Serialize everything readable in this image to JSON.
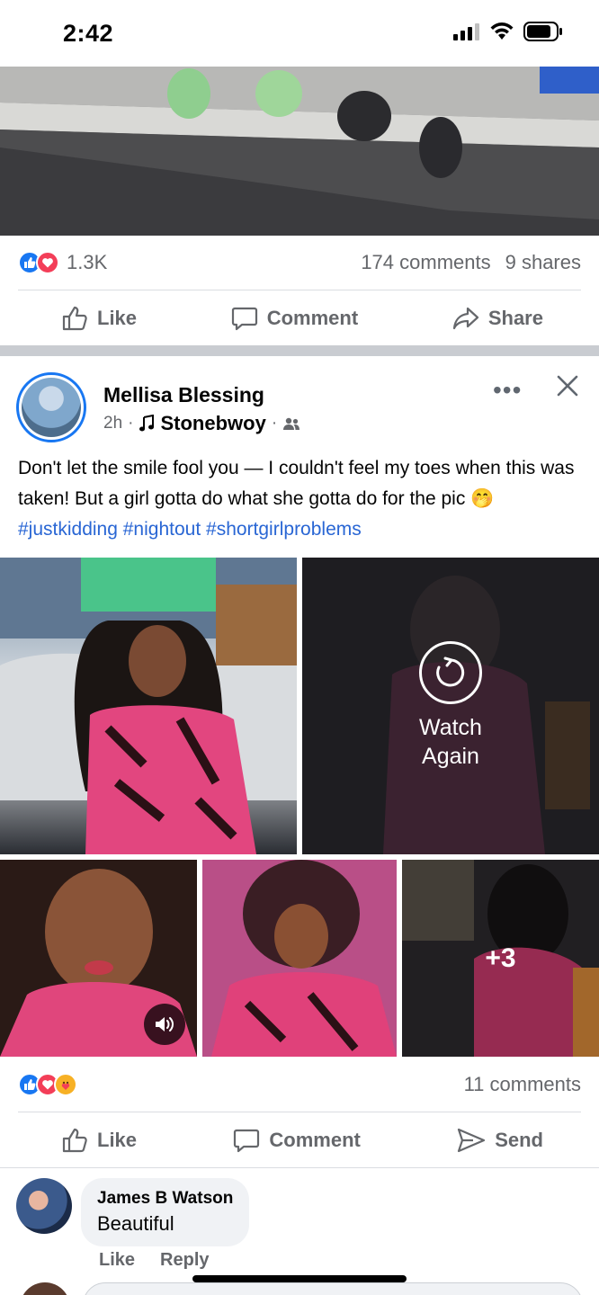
{
  "status": {
    "time": "2:42"
  },
  "top_post": {
    "reaction_count": "1.3K",
    "comments": "174 comments",
    "shares": "9 shares",
    "actions": {
      "like": "Like",
      "comment": "Comment",
      "share": "Share"
    }
  },
  "post": {
    "author": "Mellisa Blessing",
    "time": "2h",
    "song": "Stonebwoy",
    "text_plain": "Don't let the smile fool you — I couldn't feel my toes when this was taken! But a girl gotta do what she gotta do for the pic 🤭",
    "hashtags": [
      "#justkidding",
      "#nightout",
      "#shortgirlproblems"
    ],
    "watch_again": "Watch Again",
    "more_photos": "+3",
    "comments_count": "11 comments",
    "actions": {
      "like": "Like",
      "comment": "Comment",
      "send": "Send"
    }
  },
  "comment": {
    "name": "James B Watson",
    "text": "Beautiful",
    "like": "Like",
    "reply": "Reply"
  },
  "colors": {
    "brand_blue": "#1877f2",
    "love_red": "#f33e58",
    "care_yellow": "#f7b125",
    "hashtag": "#2966d4"
  }
}
